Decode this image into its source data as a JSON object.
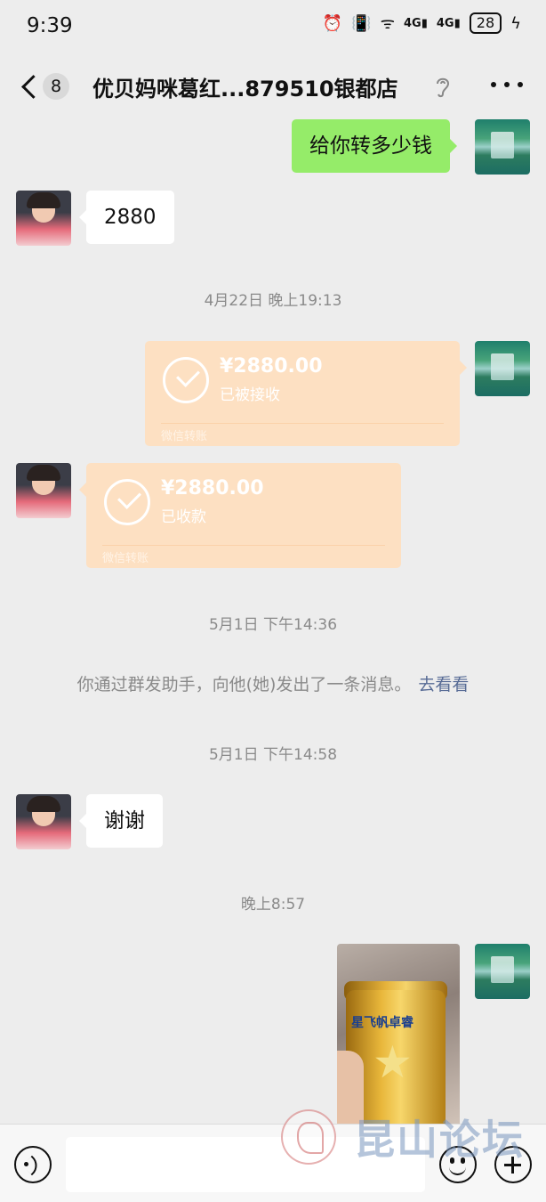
{
  "status_bar": {
    "time": "9:39",
    "signal_1": "4G",
    "signal_2": "4G",
    "battery": "28"
  },
  "header": {
    "unread_count": "8",
    "title": "优贝妈咪葛红...879510银都店"
  },
  "messages": {
    "m1_text": "给你转多少钱",
    "m2_text": "2880",
    "time_1": "4月22日 晚上19:13",
    "transfer_sent": {
      "amount": "¥2880.00",
      "status": "已被接收",
      "source": "微信转账"
    },
    "transfer_received": {
      "amount": "¥2880.00",
      "status": "已收款",
      "source": "微信转账"
    },
    "time_2": "5月1日 下午14:36",
    "notice_text": "你通过群发助手，向他(她)发出了一条消息。",
    "notice_link": "去看看",
    "time_3": "5月1日 下午14:58",
    "m3_text": "谢谢",
    "time_4": "晚上8:57",
    "photo_brand": "星飞帆卓睿"
  },
  "watermark": {
    "text": "昆山论坛"
  }
}
